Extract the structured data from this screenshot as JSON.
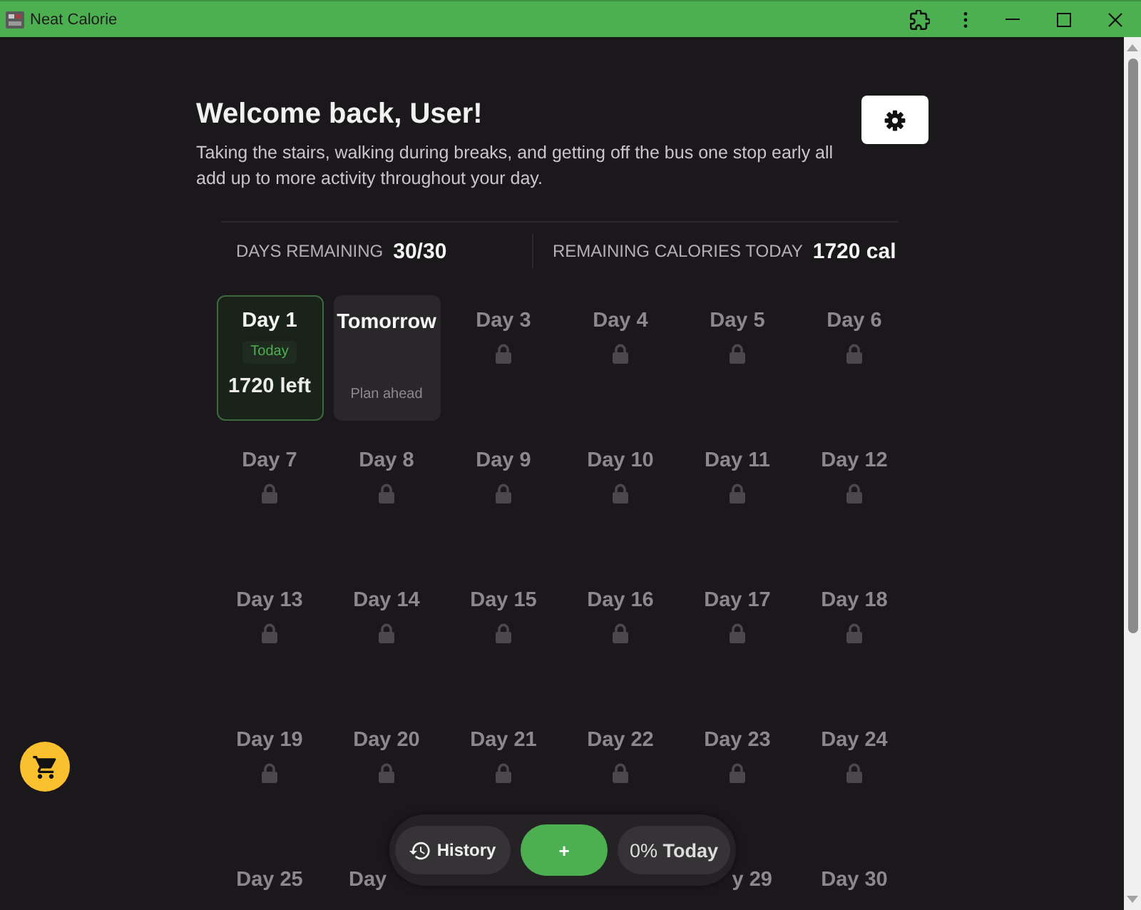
{
  "window": {
    "title": "Neat Calorie"
  },
  "header": {
    "title": "Welcome back, User!",
    "subtitle": "Taking the stairs, walking during breaks, and getting off the bus one stop early all add up to more activity throughout your day."
  },
  "stats": [
    {
      "label": "DAYS REMAINING",
      "value": "30/30"
    },
    {
      "label": "REMAINING CALORIES TODAY",
      "value": "1720 cal"
    }
  ],
  "days": [
    {
      "label": "Day 1",
      "kind": "today",
      "badge": "Today",
      "note": "1720 left"
    },
    {
      "label": "Tomorrow",
      "kind": "tomorrow",
      "note": "Plan ahead"
    },
    {
      "label": "Day 3",
      "kind": "locked"
    },
    {
      "label": "Day 4",
      "kind": "locked"
    },
    {
      "label": "Day 5",
      "kind": "locked"
    },
    {
      "label": "Day 6",
      "kind": "locked"
    },
    {
      "label": "Day 7",
      "kind": "locked"
    },
    {
      "label": "Day 8",
      "kind": "locked"
    },
    {
      "label": "Day 9",
      "kind": "locked"
    },
    {
      "label": "Day 10",
      "kind": "locked"
    },
    {
      "label": "Day 11",
      "kind": "locked"
    },
    {
      "label": "Day 12",
      "kind": "locked"
    },
    {
      "label": "Day 13",
      "kind": "locked"
    },
    {
      "label": "Day 14",
      "kind": "locked"
    },
    {
      "label": "Day 15",
      "kind": "locked"
    },
    {
      "label": "Day 16",
      "kind": "locked"
    },
    {
      "label": "Day 17",
      "kind": "locked"
    },
    {
      "label": "Day 18",
      "kind": "locked"
    },
    {
      "label": "Day 19",
      "kind": "locked"
    },
    {
      "label": "Day 20",
      "kind": "locked"
    },
    {
      "label": "Day 21",
      "kind": "locked"
    },
    {
      "label": "Day 22",
      "kind": "locked"
    },
    {
      "label": "Day 23",
      "kind": "locked"
    },
    {
      "label": "Day 24",
      "kind": "locked"
    },
    {
      "label": "Day 25",
      "kind": "cut"
    },
    {
      "label": "Day",
      "kind": "covered-right"
    },
    {
      "kind": "covered"
    },
    {
      "kind": "covered"
    },
    {
      "label": "y 29",
      "kind": "covered-left"
    },
    {
      "label": "Day 30",
      "kind": "cut"
    }
  ],
  "bottom_bar": {
    "history": "History",
    "add": "+",
    "progress": "0% **Today**"
  }
}
